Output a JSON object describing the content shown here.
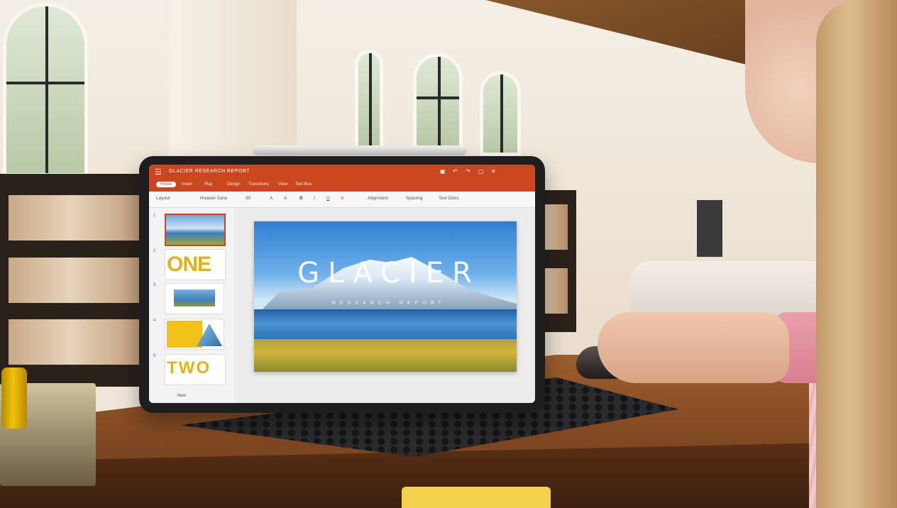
{
  "app": {
    "title": "GLACIER RESEARCH REPORT",
    "menu_icon": "hamburger-icon",
    "accent_color": "#c9461f"
  },
  "ribbon": {
    "tabs": [
      "Home",
      "Insert",
      "Play",
      "Design",
      "Transitions",
      "View",
      "Text Box"
    ]
  },
  "toolbar": {
    "layout": "Layout",
    "font": "Huawei Sans",
    "size": "30",
    "alignment": "Alignment",
    "spacing": "Spacing",
    "text_direction": "Text Direc"
  },
  "slides": {
    "numbers": [
      "1",
      "2",
      "3",
      "4",
      "5"
    ],
    "thumb_one_text": "ONE",
    "thumb_five_text": "TWO",
    "new_label": "New"
  },
  "slide": {
    "title": "GLACIER",
    "subtitle": "RESEARCH REPORT"
  }
}
